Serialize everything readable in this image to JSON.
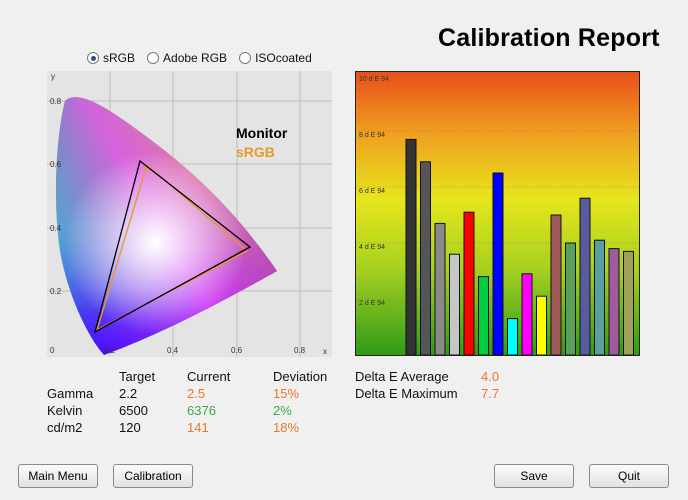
{
  "window": {
    "title": "Calibration Report"
  },
  "colors": {
    "orange": "#e8772e",
    "green": "#3fa845",
    "monitor_outline": "#000000",
    "srgb_outline": "#e69a2a"
  },
  "gamut_selector": [
    {
      "label": "sRGB",
      "selected": true
    },
    {
      "label": "Adobe RGB",
      "selected": false
    },
    {
      "label": "ISOcoated",
      "selected": false
    }
  ],
  "gamut_chart": {
    "axis_x_label": "x",
    "axis_y_label": "y",
    "x_ticks": [
      "0",
      "0.2",
      "0.4",
      "0.6",
      "0.8"
    ],
    "y_ticks": [
      "0.8",
      "0.6",
      "0.4",
      "0.2"
    ],
    "legend": [
      {
        "label": "Monitor",
        "color": "#000000"
      },
      {
        "label": "sRGB",
        "color": "#e69a2a"
      }
    ]
  },
  "chart_data": {
    "type": "bar",
    "y_tick_labels": [
      "10 d E 94",
      "8 d E 94",
      "6 d E 94",
      "4 d E 94",
      "2 d E 94"
    ],
    "ylim": [
      0,
      10
    ],
    "grid": true,
    "values": [
      7.7,
      6.9,
      4.7,
      3.6,
      5.1,
      2.8,
      6.5,
      1.3,
      2.9,
      2.1,
      5.0,
      4.0,
      5.6,
      4.1,
      3.8,
      3.7
    ],
    "bar_colors": [
      "#333333",
      "#555555",
      "#8a8a8a",
      "#c6c6c6",
      "#ff0000",
      "#00d040",
      "#0000ff",
      "#00ffff",
      "#ff00ff",
      "#ffff00",
      "#a05a5a",
      "#5aa05a",
      "#5a5aa0",
      "#5aa0a0",
      "#a05aa0",
      "#a0a05a"
    ]
  },
  "stats_table": {
    "headers": [
      "",
      "Target",
      "Current",
      "Deviation"
    ],
    "rows": [
      {
        "label": "Gamma",
        "target": "2.2",
        "current": "2.5",
        "current_color": "#e8772e",
        "deviation": "15%",
        "deviation_color": "#e8772e"
      },
      {
        "label": "Kelvin",
        "target": "6500",
        "current": "6376",
        "current_color": "#3fa845",
        "deviation": "2%",
        "deviation_color": "#3fa845"
      },
      {
        "label": "cd/m2",
        "target": "120",
        "current": "141",
        "current_color": "#e8772e",
        "deviation": "18%",
        "deviation_color": "#e8772e"
      }
    ]
  },
  "delta_e": [
    {
      "label": "Delta E Average",
      "value": "4.0"
    },
    {
      "label": "Delta E Maximum",
      "value": "7.7"
    }
  ],
  "buttons": {
    "main_menu": "Main Menu",
    "calibration": "Calibration",
    "save": "Save",
    "quit": "Quit"
  }
}
